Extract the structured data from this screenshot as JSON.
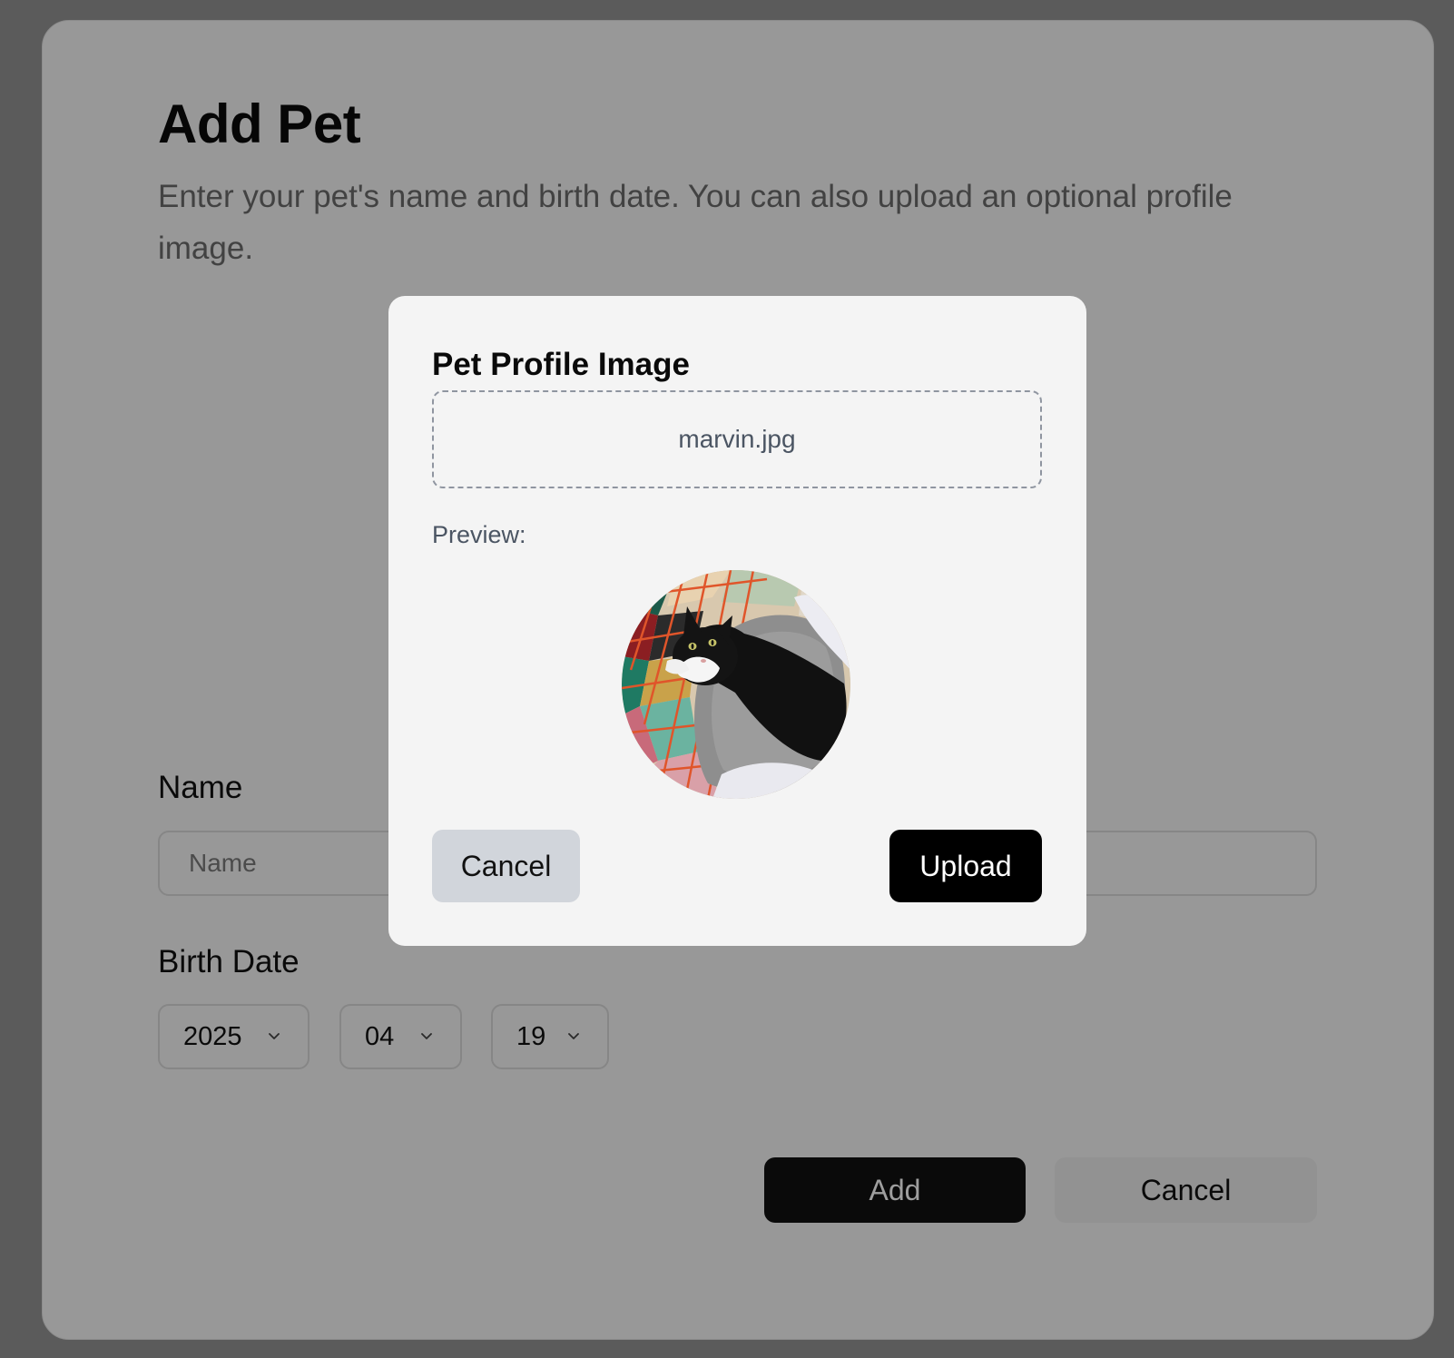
{
  "page": {
    "title": "Add Pet",
    "description": "Enter your pet's name and birth date. You can also upload an optional profile image."
  },
  "form": {
    "name_label": "Name",
    "name_placeholder": "Name",
    "name_value": "",
    "birth_label": "Birth Date",
    "year": "2025",
    "month": "04",
    "day": "19",
    "add_label": "Add",
    "cancel_label": "Cancel"
  },
  "modal": {
    "title": "Pet Profile Image",
    "file_name": "marvin.jpg",
    "preview_label": "Preview:",
    "preview_subject": "black-and-white cat on a gray cushion",
    "cancel_label": "Cancel",
    "upload_label": "Upload"
  },
  "icons": {
    "select_arrow": "chevron-down-icon"
  },
  "colors": {
    "primary_button": "#111111",
    "upload_button": "#000000",
    "secondary_button": "#d1d5db",
    "overlay": "rgba(0,0,0,0.38)"
  }
}
